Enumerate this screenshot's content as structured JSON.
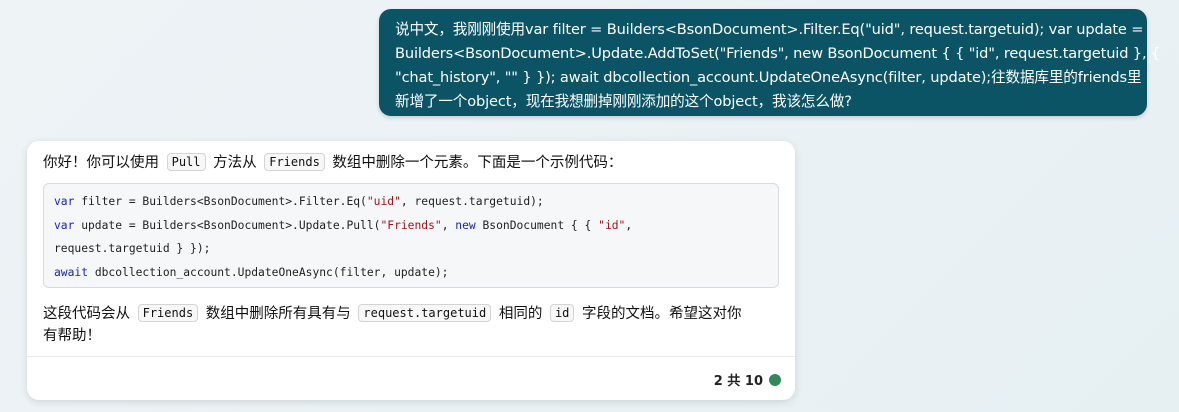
{
  "user_message": {
    "lines": [
      "说中文，我刚刚使用var filter = Builders<BsonDocument>.Filter.Eq(\"uid\", request.targetuid); var update =",
      "Builders<BsonDocument>.Update.AddToSet(\"Friends\", new BsonDocument { { \"id\", request.targetuid }, {",
      "\"chat_history\", \"\" } }); await dbcollection_account.UpdateOneAsync(filter, update);往数据库里的friends里",
      "新增了一个object，现在我想删掉刚刚添加的这个object，我该怎么做?"
    ]
  },
  "bot_message": {
    "intro_before": "你好！你可以使用",
    "intro_code_1": "Pull",
    "intro_mid": "方法从",
    "intro_code_2": "Friends",
    "intro_after": "数组中删除一个元素。下面是一个示例代码：",
    "code": {
      "l1_kw": "var",
      "l1_a": " filter = Builders<BsonDocument>.Filter.Eq(",
      "l1_str": "\"uid\"",
      "l1_b": ", request.targetuid);",
      "l2_kw": "var",
      "l2_a": " update = Builders<BsonDocument>.Update.Pull(",
      "l2_str1": "\"Friends\"",
      "l2_b": ", ",
      "l2_kw2": "new",
      "l2_c": " BsonDocument { { ",
      "l2_str2": "\"id\"",
      "l2_d": ",",
      "l3": "request.targetuid } });",
      "l4_kw": "await",
      "l4_a": " dbcollection_account.UpdateOneAsync(filter, update);"
    },
    "outro1_a": "这段代码会从",
    "outro1_code1": "Friends",
    "outro1_b": "数组中删除所有具有与",
    "outro1_code2": "request.targetuid",
    "outro1_c": "相同的",
    "outro1_code3": "id",
    "outro1_d": "字段的文档。希望这对你",
    "outro2": "有帮助！",
    "footer_label": "2 共 10",
    "status_color": "#2e8b57"
  }
}
